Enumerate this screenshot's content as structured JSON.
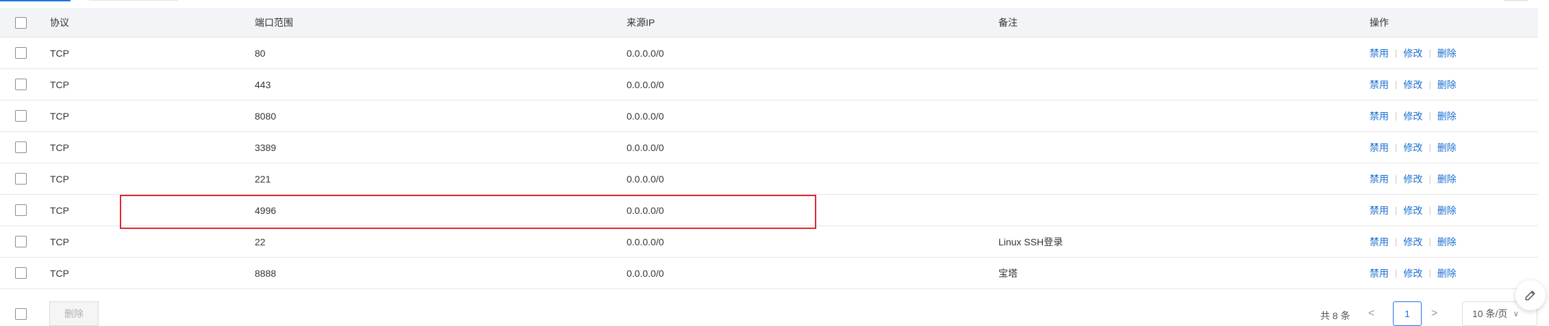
{
  "table": {
    "headers": {
      "protocol": "协议",
      "port_range": "端口范围",
      "source_ip": "来源IP",
      "note": "备注",
      "actions": "操作"
    },
    "rows": [
      {
        "protocol": "TCP",
        "port": "80",
        "source": "0.0.0.0/0",
        "note": ""
      },
      {
        "protocol": "TCP",
        "port": "443",
        "source": "0.0.0.0/0",
        "note": ""
      },
      {
        "protocol": "TCP",
        "port": "8080",
        "source": "0.0.0.0/0",
        "note": ""
      },
      {
        "protocol": "TCP",
        "port": "3389",
        "source": "0.0.0.0/0",
        "note": ""
      },
      {
        "protocol": "TCP",
        "port": "221",
        "source": "0.0.0.0/0",
        "note": ""
      },
      {
        "protocol": "TCP",
        "port": "4996",
        "source": "0.0.0.0/0",
        "note": ""
      },
      {
        "protocol": "TCP",
        "port": "22",
        "source": "0.0.0.0/0",
        "note": "Linux SSH登录"
      },
      {
        "protocol": "TCP",
        "port": "8888",
        "source": "0.0.0.0/0",
        "note": "宝塔"
      }
    ],
    "row_actions": {
      "disable": "禁用",
      "edit": "修改",
      "delete": "删除",
      "separator": "|"
    }
  },
  "footer": {
    "batch_delete": "删除",
    "total": "共 8 条",
    "prev": "<",
    "current_page": "1",
    "next": ">",
    "page_size": "10 条/页"
  },
  "colors": {
    "link": "#1a6fd1",
    "highlight_border": "#e0252b",
    "header_bg": "#f2f4f7",
    "accent": "#1a73e8"
  },
  "icons": {
    "fab": "edit-pencil-icon",
    "page_size_toggle": "chevron-down-icon"
  }
}
